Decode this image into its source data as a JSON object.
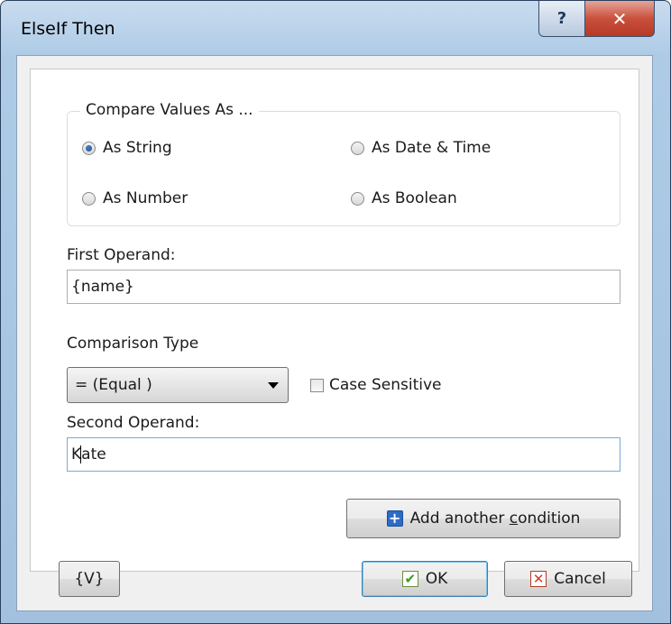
{
  "window": {
    "title": "ElseIf Then",
    "help_glyph": "?",
    "close_glyph": "✕"
  },
  "compare_group": {
    "legend": "Compare Values  As ...",
    "options": [
      {
        "label": "As String",
        "selected": true
      },
      {
        "label": "As Date & Time",
        "selected": false
      },
      {
        "label": "As Number",
        "selected": false
      },
      {
        "label": "As Boolean",
        "selected": false
      }
    ]
  },
  "first_operand": {
    "label": "First Operand:",
    "value": "{name}"
  },
  "comparison": {
    "label": "Comparison Type",
    "selected": "=  (Equal )",
    "case_sensitive_label": "Case Sensitive",
    "case_sensitive": false
  },
  "second_operand": {
    "label": "Second Operand:",
    "value_before_caret": "K",
    "value_after_caret": "ate"
  },
  "buttons": {
    "add_condition_prefix": "Add another ",
    "add_condition_accel": "c",
    "add_condition_suffix": "ondition",
    "variables": "{V}",
    "ok": "OK",
    "cancel": "Cancel"
  },
  "icons": {
    "plus": "+",
    "check": "✔",
    "cross": "✕"
  }
}
